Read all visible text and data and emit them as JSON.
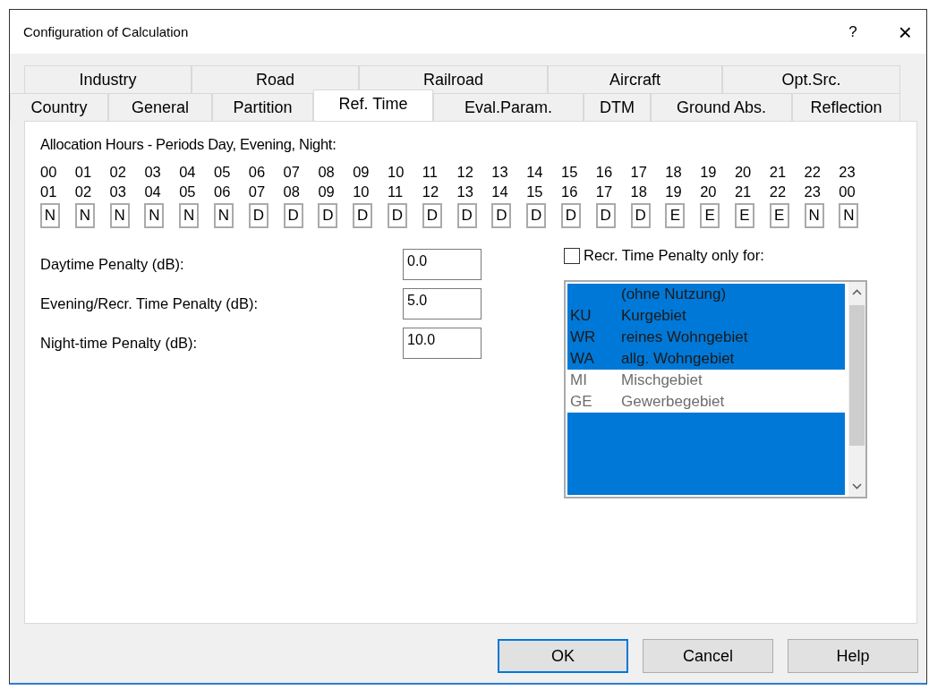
{
  "window": {
    "title": "Configuration of Calculation",
    "help_glyph": "?",
    "close_glyph": "×"
  },
  "tab_rows": [
    {
      "tabs": [
        {
          "label": "Industry",
          "selected": false
        },
        {
          "label": "Road",
          "selected": false
        },
        {
          "label": "Railroad",
          "selected": false
        },
        {
          "label": "Aircraft",
          "selected": false
        },
        {
          "label": "Opt.Src.",
          "selected": false
        }
      ]
    },
    {
      "tabs": [
        {
          "label": "Country",
          "selected": false
        },
        {
          "label": "General",
          "selected": false
        },
        {
          "label": "Partition",
          "selected": false
        },
        {
          "label": "Ref. Time",
          "selected": true
        },
        {
          "label": "Eval.Param.",
          "selected": false
        },
        {
          "label": "DTM",
          "selected": false
        },
        {
          "label": "Ground Abs.",
          "selected": false
        },
        {
          "label": "Reflection",
          "selected": false
        }
      ]
    }
  ],
  "allocation": {
    "label": "Allocation Hours - Periods Day, Evening, Night:",
    "hours": [
      {
        "from": "00",
        "to": "01",
        "period": "N"
      },
      {
        "from": "01",
        "to": "02",
        "period": "N"
      },
      {
        "from": "02",
        "to": "03",
        "period": "N"
      },
      {
        "from": "03",
        "to": "04",
        "period": "N"
      },
      {
        "from": "04",
        "to": "05",
        "period": "N"
      },
      {
        "from": "05",
        "to": "06",
        "period": "N"
      },
      {
        "from": "06",
        "to": "07",
        "period": "D"
      },
      {
        "from": "07",
        "to": "08",
        "period": "D"
      },
      {
        "from": "08",
        "to": "09",
        "period": "D"
      },
      {
        "from": "09",
        "to": "10",
        "period": "D"
      },
      {
        "from": "10",
        "to": "11",
        "period": "D"
      },
      {
        "from": "11",
        "to": "12",
        "period": "D"
      },
      {
        "from": "12",
        "to": "13",
        "period": "D"
      },
      {
        "from": "13",
        "to": "14",
        "period": "D"
      },
      {
        "from": "14",
        "to": "15",
        "period": "D"
      },
      {
        "from": "15",
        "to": "16",
        "period": "D"
      },
      {
        "from": "16",
        "to": "17",
        "period": "D"
      },
      {
        "from": "17",
        "to": "18",
        "period": "D"
      },
      {
        "from": "18",
        "to": "19",
        "period": "E"
      },
      {
        "from": "19",
        "to": "20",
        "period": "E"
      },
      {
        "from": "20",
        "to": "21",
        "period": "E"
      },
      {
        "from": "21",
        "to": "22",
        "period": "E"
      },
      {
        "from": "22",
        "to": "23",
        "period": "N"
      },
      {
        "from": "23",
        "to": "00",
        "period": "N"
      }
    ]
  },
  "penalties": [
    {
      "label": "Daytime Penalty (dB):",
      "value": "0.0"
    },
    {
      "label": "Evening/Recr. Time Penalty (dB):",
      "value": "5.0"
    },
    {
      "label": "Night-time Penalty (dB):",
      "value": "10.0"
    }
  ],
  "recreation": {
    "label": "Recr. Time Penalty only for:",
    "checked": false,
    "items": [
      {
        "name": "(ohne Nutzung)",
        "selected": true
      },
      {
        "code": "KU",
        "name": "Kurgebiet",
        "selected": true
      },
      {
        "code": "WR",
        "name": "reines Wohngebiet",
        "selected": true
      },
      {
        "code": "WA",
        "name": "allg. Wohngebiet",
        "selected": true
      },
      {
        "code": "MI",
        "name": "Mischgebiet",
        "selected": false
      },
      {
        "code": "GE",
        "name": "Gewerbegebiet",
        "selected": false
      }
    ]
  },
  "buttons": [
    {
      "label": "OK",
      "default": true
    },
    {
      "label": "Cancel",
      "default": false
    },
    {
      "label": "Help",
      "default": false
    }
  ]
}
